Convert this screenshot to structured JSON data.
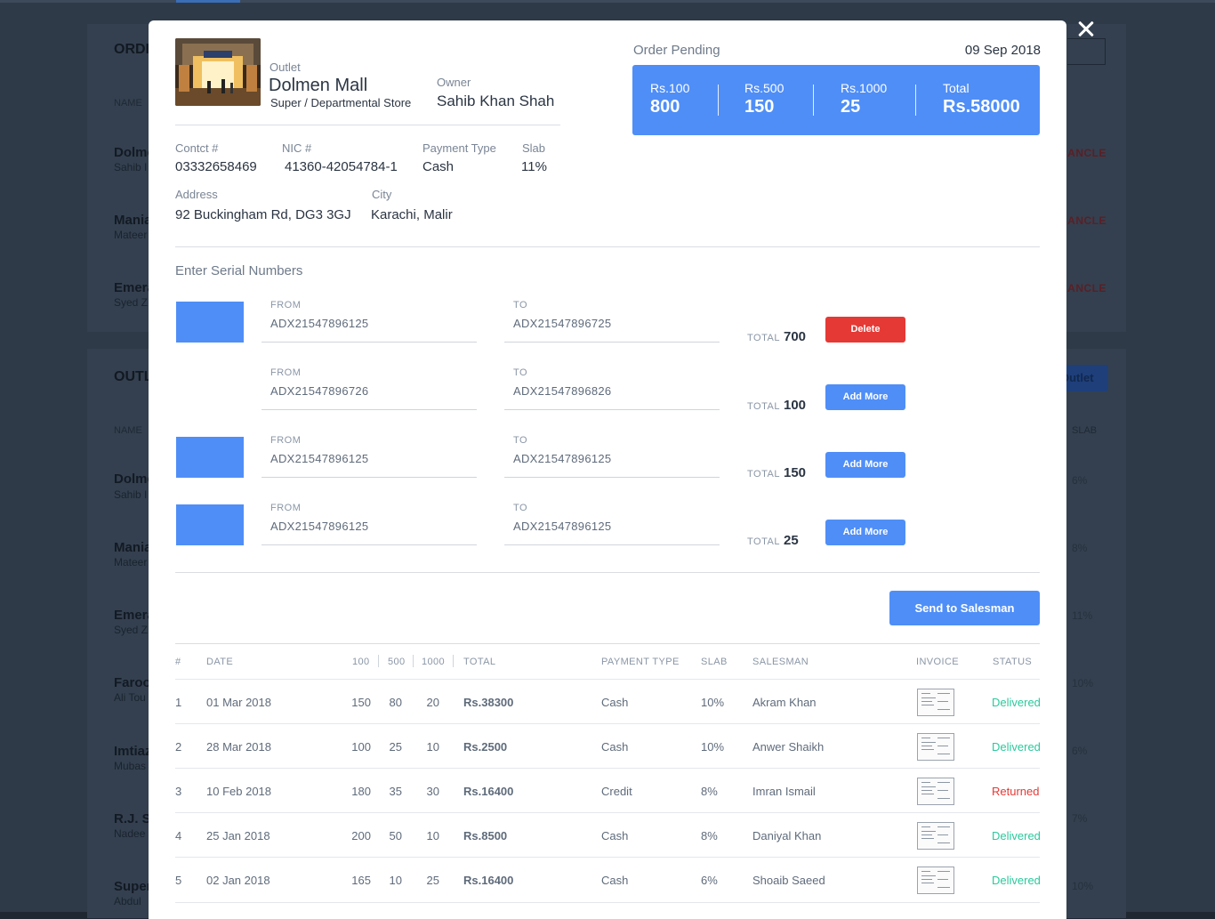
{
  "background": {
    "section_orders_title": "ORDI",
    "section_outlets_title": "OUTL",
    "col_name": "NAME",
    "col_slab": "SLAB",
    "orders": [
      {
        "name": "Dolme",
        "sub": "Sahib I",
        "action": "CANCLE"
      },
      {
        "name": "Mania",
        "sub": "Mateer",
        "action": "CANCLE"
      },
      {
        "name": "Emera",
        "sub": "Syed Z",
        "action": "CANCLE"
      }
    ],
    "outlet_button": "Outlet",
    "outlets": [
      {
        "name": "Dolme",
        "sub": "Sahib I",
        "slab": "6%"
      },
      {
        "name": "Mania",
        "sub": "Mateer",
        "slab": "8%"
      },
      {
        "name": "Emera",
        "sub": "Syed Z",
        "slab": "11%"
      },
      {
        "name": "Faroo",
        "sub": "Ali Tou",
        "slab": "10%"
      },
      {
        "name": "Imtiaz",
        "sub": "Mubas",
        "slab": "6%"
      },
      {
        "name": "R.J. S",
        "sub": "Nadee",
        "slab": "7%"
      },
      {
        "name": "Super",
        "sub": "Abdul",
        "slab": "10%"
      }
    ]
  },
  "outlet": {
    "label": "Outlet",
    "name": "Dolmen Mall",
    "type": "Super / Departmental Store",
    "owner_label": "Owner",
    "owner": "Sahib Khan Shah"
  },
  "details": {
    "contact_label": "Contct #",
    "contact": "03332658469",
    "nic_label": "NIC #",
    "nic": "41360-42054784-1",
    "payment_label": "Payment Type",
    "payment": "Cash",
    "slab_label": "Slab",
    "slab": "11%",
    "address_label": "Address",
    "address": "92 Buckingham Rd, DG3 3GJ",
    "city_label": "City",
    "city": "Karachi, Malir"
  },
  "order": {
    "status": "Order Pending",
    "date": "09 Sep 2018",
    "summary": [
      {
        "label": "Rs.100",
        "value": "800"
      },
      {
        "label": "Rs.500",
        "value": "150"
      },
      {
        "label": "Rs.1000",
        "value": "25"
      },
      {
        "label": "Total",
        "value": "Rs.58000"
      }
    ]
  },
  "serials": {
    "title": "Enter Serial Numbers",
    "from_label": "FROM",
    "to_label": "TO",
    "total_label": "TOTAL",
    "rows": [
      {
        "swatch": true,
        "from": "ADX21547896125",
        "to": "ADX21547896725",
        "total": "700",
        "action": "Delete"
      },
      {
        "swatch": false,
        "from": "ADX21547896726",
        "to": "ADX21547896826",
        "total": "100",
        "action": "Add More"
      },
      {
        "swatch": true,
        "from": "ADX21547896125",
        "to": "ADX21547896125",
        "total": "150",
        "action": "Add More"
      },
      {
        "swatch": true,
        "from": "ADX21547896125",
        "to": "ADX21547896125",
        "total": "25",
        "action": "Add More"
      }
    ],
    "swatch_color": "#4f8ef7",
    "send_button": "Send to Salesman"
  },
  "history": {
    "columns": {
      "num": "#",
      "date": "DATE",
      "c100": "100",
      "c500": "500",
      "c1000": "1000",
      "total": "TOTAL",
      "payment": "PAYMENT TYPE",
      "slab": "SLAB",
      "salesman": "SALESMAN",
      "invoice": "INVOICE",
      "status": "STATUS"
    },
    "rows": [
      {
        "num": "1",
        "date": "01 Mar 2018",
        "c100": "150",
        "c500": "80",
        "c1000": "20",
        "total": "Rs.38300",
        "payment": "Cash",
        "slab": "10%",
        "salesman": "Akram Khan",
        "status": "Delivered"
      },
      {
        "num": "2",
        "date": "28 Mar 2018",
        "c100": "100",
        "c500": "25",
        "c1000": "10",
        "total": "Rs.2500",
        "payment": "Cash",
        "slab": "10%",
        "salesman": "Anwer Shaikh",
        "status": "Delivered"
      },
      {
        "num": "3",
        "date": "10 Feb 2018",
        "c100": "180",
        "c500": "35",
        "c1000": "30",
        "total": "Rs.16400",
        "payment": "Credit",
        "slab": "8%",
        "salesman": "Imran Ismail",
        "status": "Returned"
      },
      {
        "num": "4",
        "date": "25 Jan 2018",
        "c100": "200",
        "c500": "50",
        "c1000": "10",
        "total": "Rs.8500",
        "payment": "Cash",
        "slab": "8%",
        "salesman": "Daniyal Khan",
        "status": "Delivered"
      },
      {
        "num": "5",
        "date": "02 Jan 2018",
        "c100": "165",
        "c500": "10",
        "c1000": "25",
        "total": "Rs.16400",
        "payment": "Cash",
        "slab": "6%",
        "salesman": "Shoaib Saeed",
        "status": "Delivered"
      }
    ]
  },
  "colors": {
    "accent": "#4f8ef7",
    "delete": "#e53935",
    "delivered": "#2bc99b",
    "returned": "#e53935"
  },
  "icons": {
    "close": "close-icon",
    "invoice": "invoice-thumbnail-icon",
    "outlet_photo": "outlet-photo"
  }
}
